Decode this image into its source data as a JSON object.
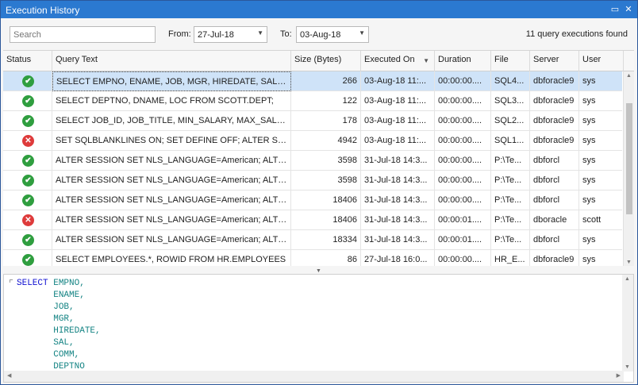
{
  "window": {
    "title": "Execution History",
    "restore_icon": "▭",
    "close_icon": "✕"
  },
  "filter": {
    "search_placeholder": "Search",
    "from_label": "From:",
    "from_value": "27-Jul-18",
    "to_label": "To:",
    "to_value": "03-Aug-18",
    "summary": "11 query executions found"
  },
  "grid": {
    "columns": [
      "Status",
      "Query Text",
      "Size (Bytes)",
      "Executed On",
      "Duration",
      "File",
      "Server",
      "User"
    ],
    "sorted_column": "Executed On",
    "rows": [
      {
        "status": "success",
        "query": "SELECT EMPNO, ENAME, JOB, MGR, HIREDATE, SAL, CO...",
        "size": "266",
        "executed": "03-Aug-18 11:...",
        "duration": "00:00:00....",
        "file": "SQL4...",
        "server": "dbforacle9",
        "user": "sys",
        "selected": true
      },
      {
        "status": "success",
        "query": "SELECT DEPTNO, DNAME, LOC FROM SCOTT.DEPT;",
        "size": "122",
        "executed": "03-Aug-18 11:...",
        "duration": "00:00:00....",
        "file": "SQL3...",
        "server": "dbforacle9",
        "user": "sys"
      },
      {
        "status": "success",
        "query": "SELECT JOB_ID, JOB_TITLE, MIN_SALARY, MAX_SALARY ...",
        "size": "178",
        "executed": "03-Aug-18 11:...",
        "duration": "00:00:00....",
        "file": "SQL2...",
        "server": "dbforacle9",
        "user": "sys"
      },
      {
        "status": "error",
        "query": "SET SQLBLANKLINES ON; SET DEFINE OFF; ALTER SESSIO...",
        "size": "4942",
        "executed": "03-Aug-18 11:...",
        "duration": "00:00:00....",
        "file": "SQL1...",
        "server": "dbforacle9",
        "user": "sys"
      },
      {
        "status": "success",
        "query": "ALTER SESSION SET NLS_LANGUAGE=American; ALTER S...",
        "size": "3598",
        "executed": "31-Jul-18 14:3...",
        "duration": "00:00:00....",
        "file": "P:\\Te...",
        "server": "dbforcl",
        "user": "sys"
      },
      {
        "status": "success",
        "query": "ALTER SESSION SET NLS_LANGUAGE=American; ALTER S...",
        "size": "3598",
        "executed": "31-Jul-18 14:3...",
        "duration": "00:00:00....",
        "file": "P:\\Te...",
        "server": "dbforcl",
        "user": "sys"
      },
      {
        "status": "success",
        "query": "ALTER SESSION SET NLS_LANGUAGE=American; ALTER S...",
        "size": "18406",
        "executed": "31-Jul-18 14:3...",
        "duration": "00:00:00....",
        "file": "P:\\Te...",
        "server": "dbforcl",
        "user": "sys"
      },
      {
        "status": "error",
        "query": "ALTER SESSION SET NLS_LANGUAGE=American; ALTER S...",
        "size": "18406",
        "executed": "31-Jul-18 14:3...",
        "duration": "00:00:01....",
        "file": "P:\\Te...",
        "server": "dboracle",
        "user": "scott"
      },
      {
        "status": "success",
        "query": "ALTER SESSION SET NLS_LANGUAGE=American; ALTER S...",
        "size": "18334",
        "executed": "31-Jul-18 14:3...",
        "duration": "00:00:01....",
        "file": "P:\\Te...",
        "server": "dbforcl",
        "user": "sys"
      },
      {
        "status": "success",
        "query": "SELECT EMPLOYEES.*, ROWID FROM HR.EMPLOYEES",
        "size": "86",
        "executed": "27-Jul-18 16:0...",
        "duration": "00:00:00....",
        "file": "HR_E...",
        "server": "dbforacle9",
        "user": "sys"
      }
    ]
  },
  "sql_preview": {
    "keyword": "SELECT",
    "columns": [
      "EMPNO,",
      "ENAME,",
      "JOB,",
      "MGR,",
      "HIREDATE,",
      "SAL,",
      "COMM,",
      "DEPTNO"
    ]
  },
  "colors": {
    "titlebar": "#2b79d0",
    "selected_row": "#cfe3f8",
    "success": "#2f9e3f",
    "error": "#de3b3b",
    "sql_keyword": "#1010d0",
    "sql_identifier": "#138383"
  }
}
